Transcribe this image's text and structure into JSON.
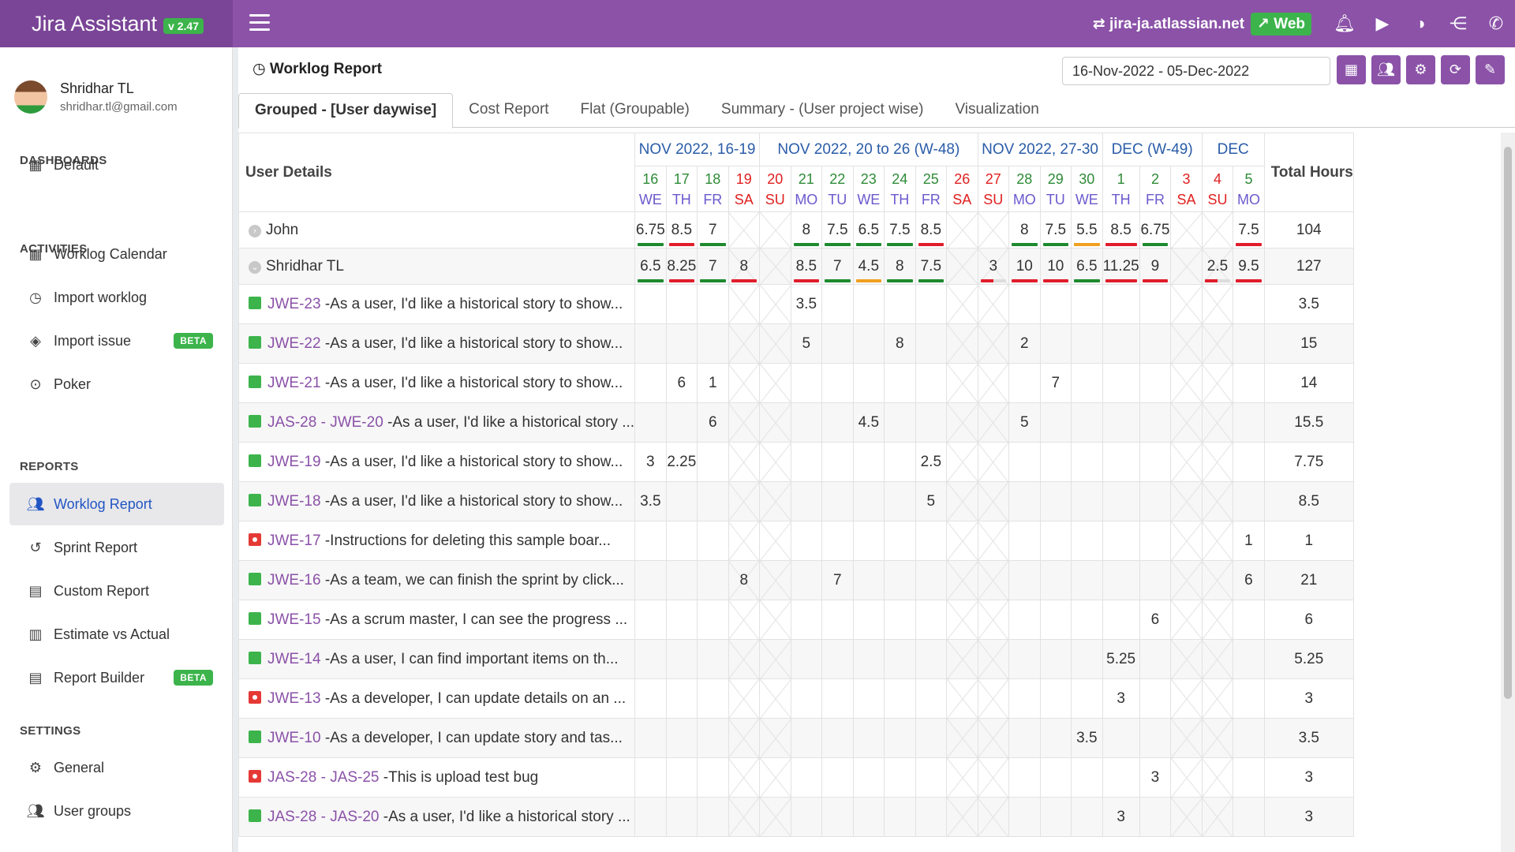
{
  "app": {
    "title": "Jira Assistant",
    "version": "v 2.47",
    "site": "jira-ja.atlassian.net",
    "web_label": "Web"
  },
  "user": {
    "name": "Shridhar TL",
    "email": "shridhar.tl@gmail.com"
  },
  "sidebar": {
    "sections": [
      {
        "title": "DASHBOARDS",
        "items": [
          {
            "label": "Default",
            "icon": "calendar-icon"
          }
        ]
      },
      {
        "title": "ACTIVITIES",
        "items": [
          {
            "label": "Worklog Calendar",
            "icon": "calendar-icon"
          },
          {
            "label": "Import worklog",
            "icon": "clock-icon"
          },
          {
            "label": "Import issue",
            "icon": "eraser-icon",
            "badge": "BETA"
          },
          {
            "label": "Poker",
            "icon": "gamepad-icon"
          }
        ]
      },
      {
        "title": "REPORTS",
        "items": [
          {
            "label": "Worklog Report",
            "icon": "users-icon",
            "active": true
          },
          {
            "label": "Sprint Report",
            "icon": "history-icon"
          },
          {
            "label": "Custom Report",
            "icon": "table-icon"
          },
          {
            "label": "Estimate vs Actual",
            "icon": "bar-chart-icon"
          },
          {
            "label": "Report Builder",
            "icon": "table-icon",
            "badge": "BETA"
          }
        ]
      },
      {
        "title": "SETTINGS",
        "items": [
          {
            "label": "General",
            "icon": "gear-icon"
          },
          {
            "label": "User groups",
            "icon": "users-icon"
          }
        ]
      }
    ]
  },
  "report": {
    "title": "Worklog Report",
    "date_range": "16-Nov-2022 - 05-Dec-2022",
    "tabs": [
      "Grouped - [User daywise]",
      "Cost Report",
      "Flat (Groupable)",
      "Summary - (User project wise)",
      "Visualization"
    ],
    "user_details_label": "User Details",
    "total_label": "Total Hours",
    "months": [
      {
        "label": "NOV 2022, 16-19",
        "span": 4
      },
      {
        "label": "NOV 2022, 20 to 26 (W-48)",
        "span": 7
      },
      {
        "label": "NOV 2022, 27-30",
        "span": 4
      },
      {
        "label": "DEC (W-49)",
        "span": 3
      },
      {
        "label": "DEC",
        "span": 2
      }
    ],
    "days": [
      {
        "d": "16",
        "w": "WE"
      },
      {
        "d": "17",
        "w": "TH"
      },
      {
        "d": "18",
        "w": "FR"
      },
      {
        "d": "19",
        "w": "SA",
        "off": true
      },
      {
        "d": "20",
        "w": "SU",
        "off": true
      },
      {
        "d": "21",
        "w": "MO"
      },
      {
        "d": "22",
        "w": "TU"
      },
      {
        "d": "23",
        "w": "WE"
      },
      {
        "d": "24",
        "w": "TH"
      },
      {
        "d": "25",
        "w": "FR"
      },
      {
        "d": "26",
        "w": "SA",
        "off": true
      },
      {
        "d": "27",
        "w": "SU",
        "off": true
      },
      {
        "d": "28",
        "w": "MO"
      },
      {
        "d": "29",
        "w": "TU"
      },
      {
        "d": "30",
        "w": "WE"
      },
      {
        "d": "1",
        "w": "TH"
      },
      {
        "d": "2",
        "w": "FR"
      },
      {
        "d": "3",
        "w": "SA",
        "off": true
      },
      {
        "d": "4",
        "w": "SU",
        "off": true
      },
      {
        "d": "5",
        "w": "MO"
      }
    ],
    "rows": [
      {
        "type": "user",
        "expanded": false,
        "name": "John",
        "total": "104",
        "cells": [
          "6.75",
          "8.5",
          "7",
          "",
          "",
          "8",
          "7.5",
          "6.5",
          "7.5",
          "8.5",
          "",
          "",
          "8",
          "7.5",
          "5.5",
          "8.5",
          "6.75",
          "",
          "",
          "7.5"
        ],
        "bars": [
          "g",
          "r",
          "g",
          "",
          "",
          "g",
          "g",
          "g",
          "g",
          "r",
          "",
          "",
          "g",
          "g",
          "o",
          "r",
          "g",
          "",
          "",
          "r"
        ]
      },
      {
        "type": "user",
        "expanded": true,
        "name": "Shridhar TL",
        "total": "127",
        "cells": [
          "6.5",
          "8.25",
          "7",
          "8",
          "",
          "8.5",
          "7",
          "4.5",
          "8",
          "7.5",
          "",
          "3",
          "10",
          "10",
          "6.5",
          "11.25",
          "9",
          "",
          "2.5",
          "9.5"
        ],
        "bars": [
          "g",
          "r",
          "g",
          "r",
          "",
          "r",
          "g",
          "o",
          "g",
          "g",
          "",
          "rp",
          "r",
          "r",
          "g",
          "r",
          "r",
          "",
          "rp",
          "r"
        ]
      },
      {
        "type": "item",
        "icon": "story",
        "key": "JWE-23",
        "summary": " -As a user, I'd like a historical story to show...",
        "total": "3.5",
        "cells": {
          "5": "3.5"
        }
      },
      {
        "type": "item",
        "icon": "story",
        "key": "JWE-22",
        "summary": " -As a user, I'd like a historical story to show...",
        "total": "15",
        "cells": {
          "5": "5",
          "8": "8",
          "12": "2"
        }
      },
      {
        "type": "item",
        "icon": "story",
        "key": "JWE-21",
        "summary": " -As a user, I'd like a historical story to show...",
        "total": "14",
        "cells": {
          "1": "6",
          "2": "1",
          "13": "7"
        }
      },
      {
        "type": "item",
        "icon": "story",
        "key": "JAS-28 - JWE-20",
        "summary": " -As a user, I'd like a historical story ...",
        "total": "15.5",
        "cells": {
          "2": "6",
          "7": "4.5",
          "12": "5"
        }
      },
      {
        "type": "item",
        "icon": "story",
        "key": "JWE-19",
        "summary": " -As a user, I'd like a historical story to show...",
        "total": "7.75",
        "cells": {
          "0": "3",
          "1": "2.25",
          "9": "2.5"
        }
      },
      {
        "type": "item",
        "icon": "story",
        "key": "JWE-18",
        "summary": " -As a user, I'd like a historical story to show...",
        "total": "8.5",
        "cells": {
          "0": "3.5",
          "9": "5"
        }
      },
      {
        "type": "item",
        "icon": "bug",
        "key": "JWE-17",
        "summary": " -Instructions for deleting this sample boar...",
        "total": "1",
        "cells": {
          "19": "1"
        }
      },
      {
        "type": "item",
        "icon": "story",
        "key": "JWE-16",
        "summary": " -As a team, we can finish the sprint by click...",
        "total": "21",
        "cells": {
          "3": "8",
          "6": "7",
          "19": "6"
        }
      },
      {
        "type": "item",
        "icon": "story",
        "key": "JWE-15",
        "summary": " -As a scrum master, I can see the progress ...",
        "total": "6",
        "cells": {
          "16": "6"
        }
      },
      {
        "type": "item",
        "icon": "story",
        "key": "JWE-14",
        "summary": " -As a user, I can find important items on th...",
        "total": "5.25",
        "cells": {
          "15": "5.25"
        }
      },
      {
        "type": "item",
        "icon": "bug",
        "key": "JWE-13",
        "summary": " -As a developer, I can update details on an ...",
        "total": "3",
        "cells": {
          "15": "3"
        }
      },
      {
        "type": "item",
        "icon": "story",
        "key": "JWE-10",
        "summary": " -As a developer, I can update story and tas...",
        "total": "3.5",
        "cells": {
          "14": "3.5"
        }
      },
      {
        "type": "item",
        "icon": "bug",
        "key": "JAS-28 - JAS-25",
        "summary": " -This is upload test bug",
        "total": "3",
        "cells": {
          "16": "3"
        }
      },
      {
        "type": "item",
        "icon": "story",
        "key": "JAS-28 - JAS-20",
        "summary": " -As a user, I'd like a historical story ...",
        "total": "3",
        "cells": {
          "15": "3"
        }
      }
    ]
  },
  "colors": {
    "topbar": "#8b52a8",
    "accent_green": "#3cb44b",
    "bar_green": "#1e8a2e",
    "bar_red": "#e11d2b",
    "bar_orange": "#f0a020"
  }
}
